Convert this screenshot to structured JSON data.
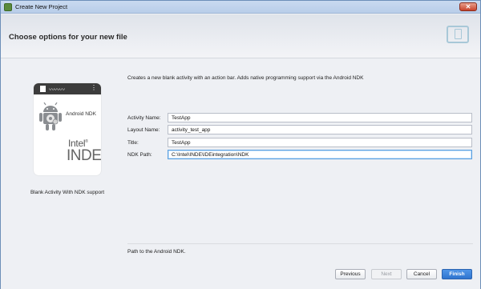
{
  "window": {
    "title": "Create New Project"
  },
  "header": {
    "heading": "Choose options for your new file"
  },
  "preview": {
    "ndk_label": "Android NDK",
    "brand_line1": "Intel",
    "brand_reg": "®",
    "brand_line2": "INDE",
    "caption": "Blank Activity With NDK support",
    "squiggle": "〰〰〰",
    "dots": "⋮"
  },
  "description": "Creates a new blank activity with an action bar. Adds native programming support via the Android NDK",
  "form": {
    "activity_name_label": "Activity Name:",
    "activity_name_value": "TestApp",
    "layout_name_label": "Layout Name:",
    "layout_name_value": "activity_test_app",
    "title_label": "Title:",
    "title_value": "TestApp",
    "ndk_path_label": "NDK Path:",
    "ndk_path_value": "C:\\Intel\\INDE\\IDEintegration\\NDK"
  },
  "hint": "Path to the Android NDK.",
  "buttons": {
    "previous": "Previous",
    "next": "Next",
    "cancel": "Cancel",
    "finish": "Finish"
  },
  "icons": {
    "close": "close-icon",
    "app": "android-studio-icon",
    "device": "device-icon",
    "android": "android-robot-icon"
  },
  "colors": {
    "primary_button": "#2f74cf",
    "focus_border": "#5aa0e0",
    "close_button": "#c8432b"
  }
}
